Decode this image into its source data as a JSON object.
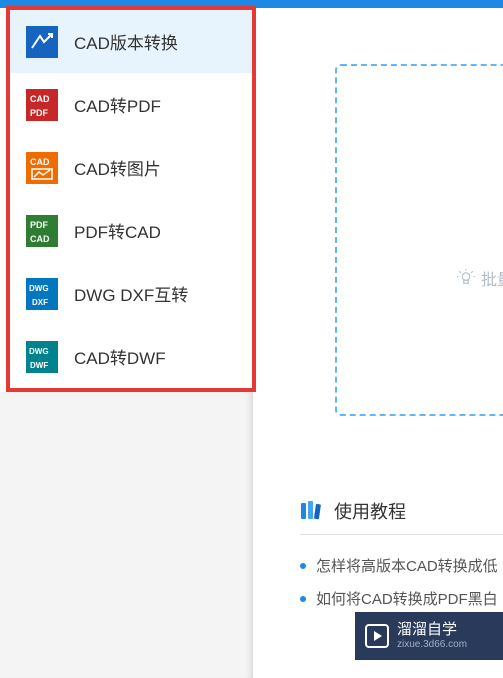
{
  "sidebar": {
    "items": [
      {
        "label": "CAD版本转换",
        "icon": "cad-version-icon",
        "selected": true
      },
      {
        "label": "CAD转PDF",
        "icon": "cad-to-pdf-icon",
        "selected": false
      },
      {
        "label": "CAD转图片",
        "icon": "cad-to-image-icon",
        "selected": false
      },
      {
        "label": "PDF转CAD",
        "icon": "pdf-to-cad-icon",
        "selected": false
      },
      {
        "label": "DWG DXF互转",
        "icon": "dwg-dxf-icon",
        "selected": false
      },
      {
        "label": "CAD转DWF",
        "icon": "cad-to-dwf-icon",
        "selected": false
      }
    ]
  },
  "dropzone": {
    "hint_prefix": "批量"
  },
  "tutorial": {
    "title": "使用教程",
    "items": [
      "怎样将高版本CAD转换成低",
      "如何将CAD转换成PDF黑白"
    ]
  },
  "watermark": {
    "title": "溜溜自学",
    "sub": "zixue.3d66.com"
  },
  "colors": {
    "accent": "#1e88e5",
    "highlight_border": "#e53935",
    "folder": "#fdd835"
  }
}
